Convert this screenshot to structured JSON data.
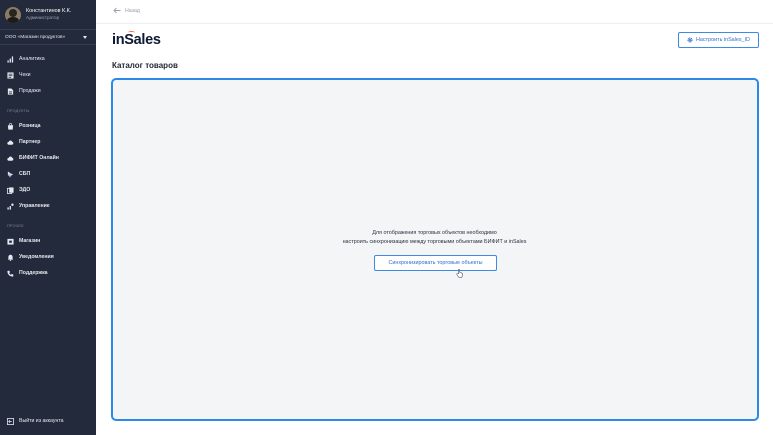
{
  "sidebar": {
    "user_name": "Константинов К.К.",
    "user_role": "Администратор",
    "org": "ООО «Магазин продуктов»",
    "items_top": [
      {
        "label": "Аналитика",
        "icon": "bar-chart-icon"
      },
      {
        "label": "Чеки",
        "icon": "receipt-icon"
      },
      {
        "label": "Продажи",
        "icon": "document-icon"
      }
    ],
    "section_products": "ПРОДУКТЫ",
    "items_products": [
      {
        "label": "Розница",
        "icon": "shopping-bag-icon"
      },
      {
        "label": "Партнер",
        "icon": "cloud-icon"
      },
      {
        "label": "БИФИТ Онлайн",
        "icon": "cloud-icon"
      },
      {
        "label": "СБП",
        "icon": "sbp-icon"
      },
      {
        "label": "ЭДО",
        "icon": "edo-icon"
      },
      {
        "label": "Управление",
        "icon": "management-icon"
      }
    ],
    "section_other": "ПРОЧЕЕ",
    "items_other": [
      {
        "label": "Магазин",
        "icon": "store-icon"
      },
      {
        "label": "Уведомления",
        "icon": "bell-icon"
      },
      {
        "label": "Поддержка",
        "icon": "phone-icon"
      }
    ],
    "logout": "Выйти из аккаунта"
  },
  "main": {
    "back": "Назад",
    "logo": "inSales",
    "settings_button": "Настроить inSales_ID",
    "title": "Каталог товаров",
    "message_line1": "Для отображения торговых объектов необходимо",
    "message_line2": "настроить синхронизацию между торговыми объектами БИФИТ и inSales",
    "sync_button": "Синхронизировать торговые объекты"
  },
  "colors": {
    "sidebar_bg": "#232a3b",
    "accent": "#2b8ae8",
    "logo_accent": "#ff6a3d"
  }
}
